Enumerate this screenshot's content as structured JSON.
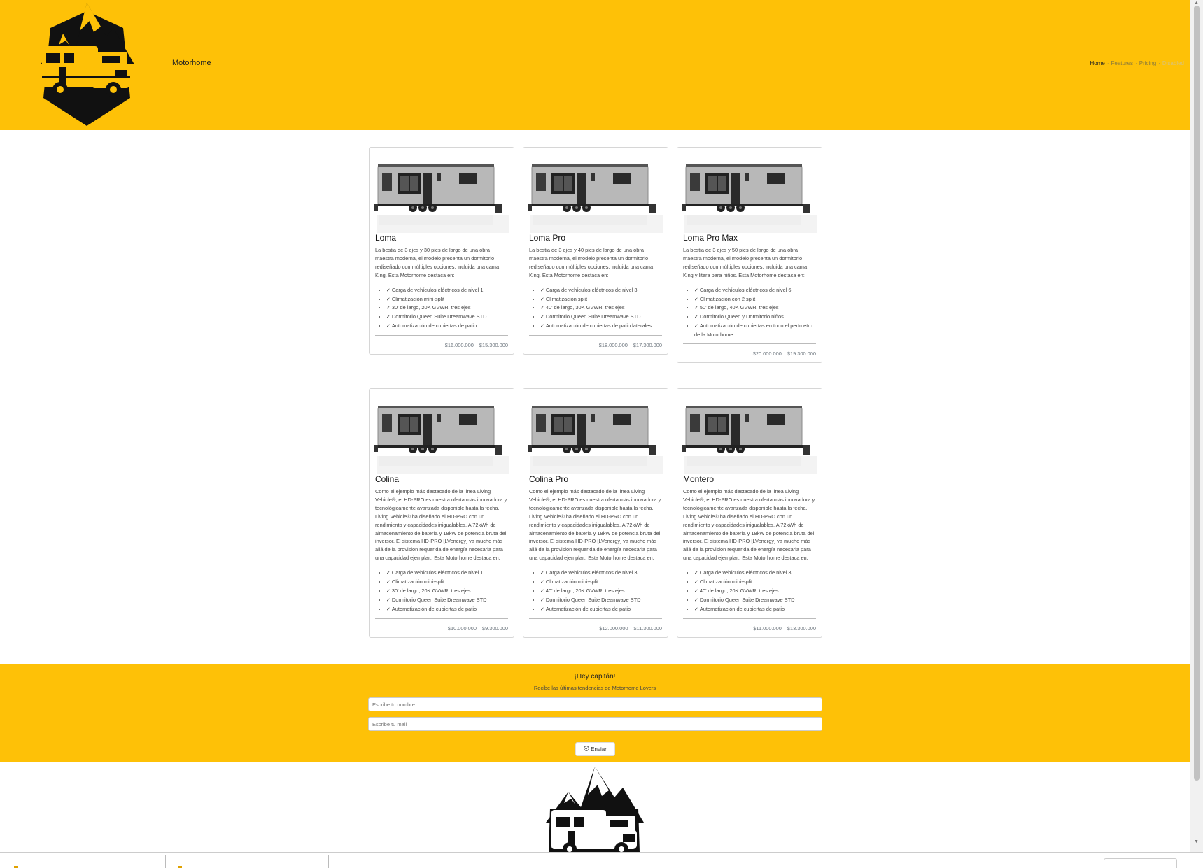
{
  "header": {
    "brand": "Motorhome",
    "logo_icon": "motorhome-mountain-logo",
    "nav": [
      {
        "label": "Home",
        "state": "active"
      },
      {
        "label": "Features",
        "state": "normal"
      },
      {
        "label": "Pricing",
        "state": "normal"
      },
      {
        "label": "Disabled",
        "state": "disabled"
      }
    ]
  },
  "colors": {
    "accent": "#fec107",
    "text": "#333333",
    "muted": "#6c757d"
  },
  "cards": [
    {
      "title": "Loma",
      "text": "La bestia de 3 ejes y 30 pies de largo de una obra maestra moderna, el modelo presenta un dormitorio rediseñado con múltiples opciones, incluida una cama King. Esta Motorhome destaca en:",
      "features": [
        "Carga de vehículos eléctricos de nivel 1",
        "Climatización mini-split",
        "30' de largo, 20K GVWR, tres ejes",
        "Dormitorio Queen Suite Dreamwave STD",
        "Automatización de cubiertas de patio"
      ],
      "price_old": "$16.000.000",
      "price_new": "$15.300.000"
    },
    {
      "title": "Loma Pro",
      "text": "La bestia de 3 ejes y 40 pies de largo de una obra maestra moderna, el modelo presenta un dormitorio rediseñado con múltiples opciones, incluida una cama King. Esta Motorhome destaca en:",
      "features": [
        "Carga de vehículos eléctricos de nivel 3",
        "Climatización split",
        "40' de largo, 30K GVWR, tres ejes",
        "Dormitorio Queen Suite Dreamwave STD",
        "Automatización de cubiertas de patio laterales"
      ],
      "price_old": "$18.000.000",
      "price_new": "$17.300.000"
    },
    {
      "title": "Loma Pro Max",
      "text": "La bestia de 3 ejes y 50 pies de largo de una obra maestra moderna, el modelo presenta un dormitorio rediseñado con múltiples opciones, incluida una cama King y litera para niños. Esta Motorhome destaca en:",
      "features": [
        "Carga de vehículos eléctricos de nivel 6",
        "Climatización con 2 split",
        "50' de largo, 40K GVWR, tres ejes",
        "Dormitorio Queen y Dormitorio niños",
        "Automatización de cubiertas en todo el perímetro de la Motorhome"
      ],
      "price_old": "$20.000.000",
      "price_new": "$19.300.000"
    },
    {
      "title": "Colina",
      "text": "Como el ejemplo más destacado de la línea Living Vehicle®, el HD-PRO es nuestra oferta más innovadora y tecnológicamente avanzada disponible hasta la fecha. Living Vehicle® ha diseñado el HD-PRO con un rendimiento y capacidades inigualables. A 72kWh de almacenamiento de batería y 18kW de potencia bruta del inversor. El sistema HD-PRO [LVenergy] va mucho más allá de la provisión requerida de energía necesaria para una capacidad ejemplar.. Esta Motorhome destaca en:",
      "features": [
        "Carga de vehículos eléctricos de nivel 1",
        "Climatización mini-split",
        "30' de largo, 20K GVWR, tres ejes",
        "Dormitorio Queen Suite Dreamwave STD",
        "Automatización de cubiertas de patio"
      ],
      "price_old": "$10.000.000",
      "price_new": "$9.300.000"
    },
    {
      "title": "Colina Pro",
      "text": "Como el ejemplo más destacado de la línea Living Vehicle®, el HD-PRO es nuestra oferta más innovadora y tecnológicamente avanzada disponible hasta la fecha. Living Vehicle® ha diseñado el HD-PRO con un rendimiento y capacidades inigualables. A 72kWh de almacenamiento de batería y 18kW de potencia bruta del inversor. El sistema HD-PRO [LVenergy] va mucho más allá de la provisión requerida de energía necesaria para una capacidad ejemplar.. Esta Motorhome destaca en:",
      "features": [
        "Carga de vehículos eléctricos de nivel 3",
        "Climatización mini-split",
        "40' de largo, 20K GVWR, tres ejes",
        "Dormitorio Queen Suite Dreamwave STD",
        "Automatización de cubiertas de patio"
      ],
      "price_old": "$12.000.000",
      "price_new": "$11.300.000"
    },
    {
      "title": "Montero",
      "text": "Como el ejemplo más destacado de la línea Living Vehicle®, el HD-PRO es nuestra oferta más innovadora y tecnológicamente avanzada disponible hasta la fecha. Living Vehicle® ha diseñado el HD-PRO con un rendimiento y capacidades inigualables. A 72kWh de almacenamiento de batería y 18kW de potencia bruta del inversor. El sistema HD-PRO [LVenergy] va mucho más allá de la provisión requerida de energía necesaria para una capacidad ejemplar.. Esta Motorhome destaca en:",
      "features": [
        "Carga de vehículos eléctricos de nivel 3",
        "Climatización mini-split",
        "40' de largo, 20K GVWR, tres ejes",
        "Dormitorio Queen Suite Dreamwave STD",
        "Automatización de cubiertas de patio"
      ],
      "price_old": "$11.000.000",
      "price_new": "$13.300.000"
    }
  ],
  "newsletter": {
    "title": "¡Hey capitán!",
    "subtitle": "Recibe las últimas tendencias de Motorhome Lovers",
    "name_placeholder": "Escribe tu nombre",
    "email_placeholder": "Escribe tu mail",
    "submit_label": "Enviar",
    "submit_icon": "check-circle-icon"
  },
  "footer": {
    "logo_icon": "motorhome-mountain-logo"
  }
}
